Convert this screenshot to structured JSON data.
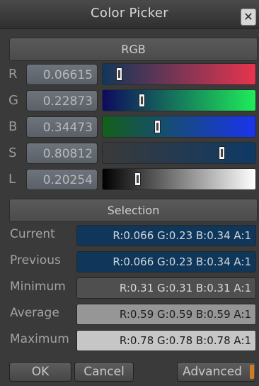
{
  "window": {
    "title": "Color Picker",
    "close_glyph": "✕"
  },
  "rgb_section": {
    "label": "RGB"
  },
  "channels": [
    {
      "letter": "R",
      "value": "0.06615",
      "fraction": 0.06615
    },
    {
      "letter": "G",
      "value": "0.22873",
      "fraction": 0.22873
    },
    {
      "letter": "B",
      "value": "0.34473",
      "fraction": 0.34473
    },
    {
      "letter": "S",
      "value": "0.80812",
      "fraction": 0.80812
    },
    {
      "letter": "L",
      "value": "0.20254",
      "fraction": 0.20254
    }
  ],
  "selection_section": {
    "label": "Selection"
  },
  "selection": [
    {
      "label": "Current",
      "value": "R:0.066 G:0.23 B:0.34 A:1",
      "swatch": "#10375a",
      "text_color": "#cfd7df"
    },
    {
      "label": "Previous",
      "value": "R:0.066 G:0.23 B:0.34 A:1",
      "swatch": "#10375a",
      "text_color": "#cfd7df"
    },
    {
      "label": "Minimum",
      "value": "R:0.31 G:0.31 B:0.31 A:1",
      "swatch": "#4f4f4f",
      "text_color": "#d8d8d8"
    },
    {
      "label": "Average",
      "value": "R:0.59 G:0.59 B:0.59 A:1",
      "swatch": "#969696",
      "text_color": "#1c1c1c"
    },
    {
      "label": "Maximum",
      "value": "R:0.78 G:0.78 B:0.78 A:1",
      "swatch": "#c6c6c6",
      "text_color": "#1c1c1c"
    }
  ],
  "buttons": {
    "ok": "OK",
    "cancel": "Cancel",
    "advanced": "Advanced"
  },
  "colors": {
    "accent_orange": "#d07a24",
    "current_color": "#10375a"
  }
}
